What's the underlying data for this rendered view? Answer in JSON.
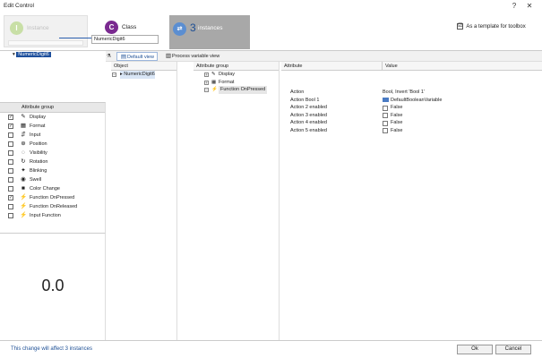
{
  "window": {
    "title": "Edit Control",
    "help_label": "?",
    "close_label": "✕"
  },
  "wizard": {
    "instance_label": "Instance",
    "instance_letter": "I",
    "class_label": "Class",
    "class_letter": "C",
    "class_value": "NumericDigit6",
    "instances_count": "3",
    "instances_label": "instances",
    "template_label": "As a template for toolbox",
    "template_checked": "☑"
  },
  "tree": {
    "root_label": "NumericDigit6"
  },
  "attribute_groups": {
    "header": "Attribute group",
    "items": [
      {
        "label": "Display",
        "checked": "✓",
        "icon": "✎"
      },
      {
        "label": "Format",
        "checked": "✓",
        "icon": "▦"
      },
      {
        "label": "Input",
        "checked": "",
        "icon": "⇵"
      },
      {
        "label": "Position",
        "checked": "",
        "icon": "⊕"
      },
      {
        "label": "Visibility",
        "checked": "",
        "icon": "◌"
      },
      {
        "label": "Rotation",
        "checked": "",
        "icon": "↻"
      },
      {
        "label": "Blinking",
        "checked": "",
        "icon": "✦"
      },
      {
        "label": "Swell",
        "checked": "",
        "icon": "◉"
      },
      {
        "label": "Color Change",
        "checked": "",
        "icon": "■"
      },
      {
        "label": "Function OnPressed",
        "checked": "✓",
        "icon": "⚡"
      },
      {
        "label": "Function OnReleased",
        "checked": "",
        "icon": "⚡"
      },
      {
        "label": "Input Function",
        "checked": "",
        "icon": "⚡"
      }
    ]
  },
  "preview": {
    "value": "0.0"
  },
  "toolbar": {
    "filter_icon": "⚗",
    "default_view_label": "Default view",
    "process_variable_label": "Process variable view"
  },
  "grid": {
    "object_header": "Object",
    "object_item": "NumericDigit6",
    "group_header": "Attribute group",
    "groups": [
      "Display",
      "Format",
      "Function OnPressed"
    ],
    "attribute_header": "Attribute",
    "value_header": "Value",
    "attributes": [
      {
        "name": "Action",
        "value": "Bool, Invert 'Bool 1'"
      },
      {
        "name": "Action Bool 1",
        "value": "DefaultBooleanVariable"
      },
      {
        "name": "Action 2 enabled",
        "value": "False"
      },
      {
        "name": "Action 3 enabled",
        "value": "False"
      },
      {
        "name": "Action 4 enabled",
        "value": "False"
      },
      {
        "name": "Action 5 enabled",
        "value": "False"
      }
    ]
  },
  "footer": {
    "message": "This change will affect 3 instances",
    "ok_label": "Ok",
    "cancel_label": "Cancel"
  },
  "colors": {
    "accent": "#1d4f9c",
    "class_badge": "#7a2a90",
    "instances_bg": "#a8a8a8"
  }
}
